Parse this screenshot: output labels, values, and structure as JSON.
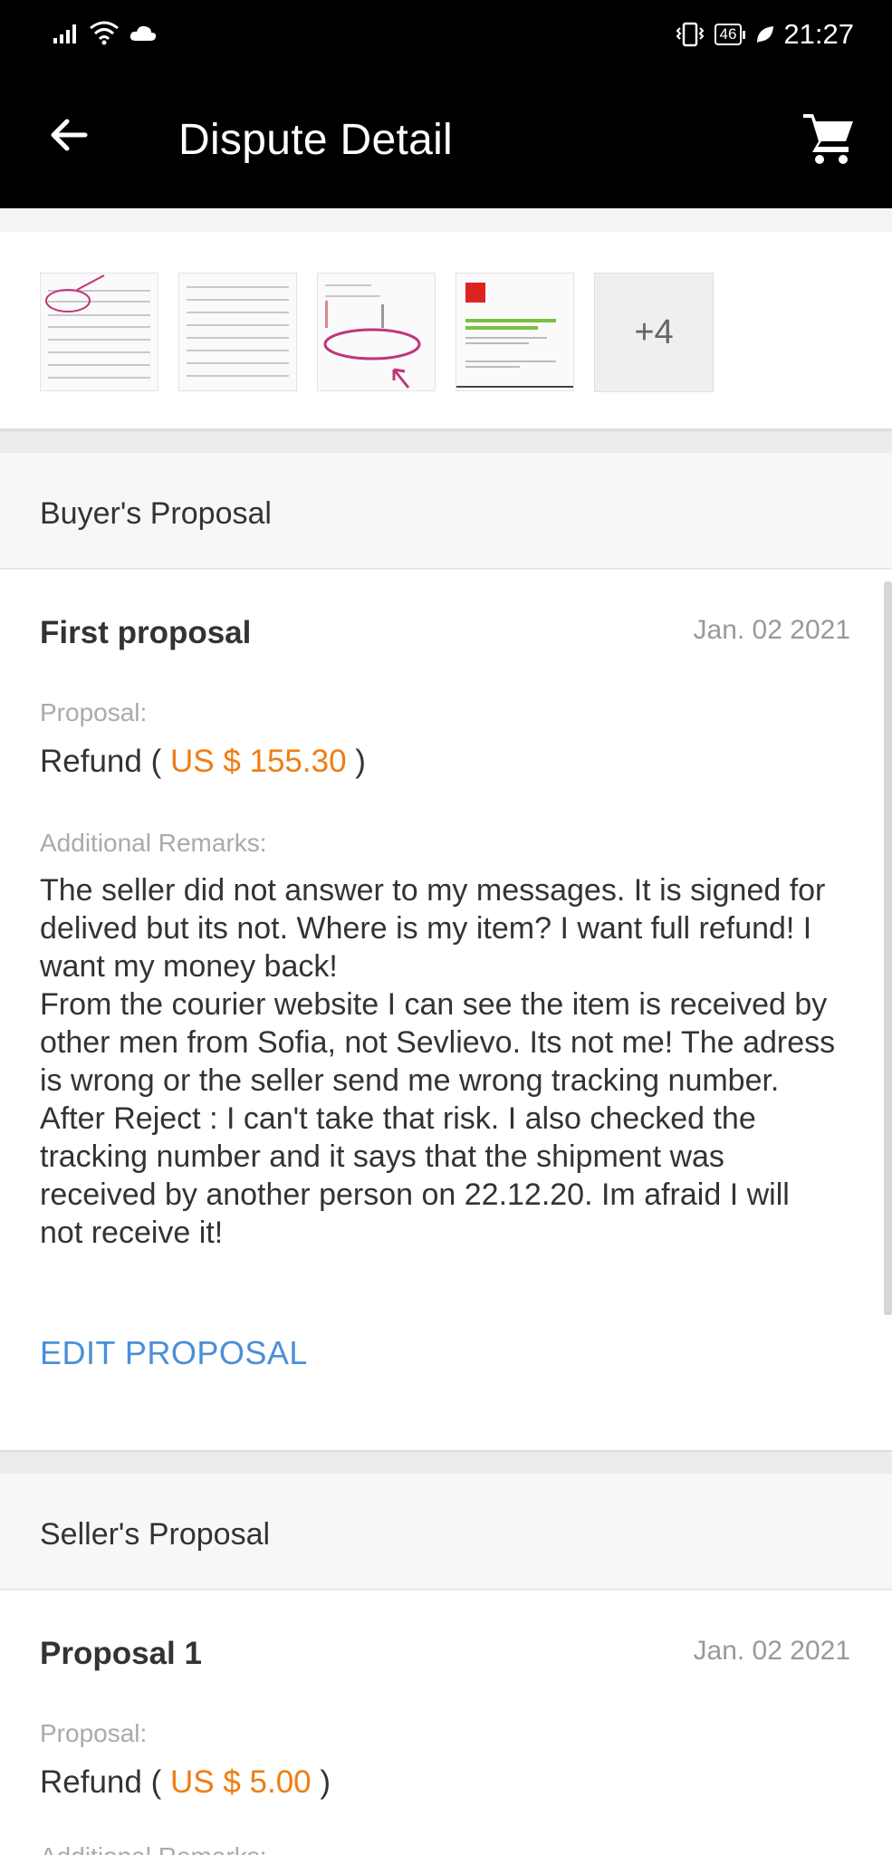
{
  "status_bar": {
    "time": "21:27",
    "battery": "46",
    "icons": [
      "signal-icon",
      "wifi-icon",
      "cloud-icon",
      "vibrate-icon",
      "battery-icon",
      "leaf-icon"
    ]
  },
  "app_bar": {
    "title": "Dispute Detail",
    "back_icon": "arrow-left-icon",
    "cart_icon": "cart-icon",
    "background": "#000000"
  },
  "evidence": {
    "thumbnails": [
      "thumb-1",
      "thumb-2",
      "thumb-3",
      "thumb-4"
    ],
    "more_label": "+4"
  },
  "buyer": {
    "header": "Buyer's Proposal",
    "title": "First proposal",
    "date": "Jan. 02 2021",
    "proposal_label": "Proposal:",
    "refund_prefix": "Refund ( ",
    "amount": "US $ 155.30",
    "refund_suffix": " )",
    "remarks_label": "Additional Remarks:",
    "remarks": "The seller did not answer to my messages. It is signed for delived but its not. Where is my item? I want full refund! I want my money back!\nFrom the courier website I can see the item is received by other men from Sofia, not Sevlievo. Its not me! The adress is wrong or the seller send me wrong tracking number.\nAfter Reject : I can't take that risk. I also checked the tracking number and it says that the shipment was received by another person on 22.12.20. Im afraid I will not receive it!",
    "edit_label": "EDIT PROPOSAL"
  },
  "seller": {
    "header": "Seller's Proposal",
    "title": "Proposal 1",
    "date": "Jan. 02 2021",
    "proposal_label": "Proposal:",
    "refund_prefix": "Refund ( ",
    "amount": "US $ 5.00",
    "refund_suffix": " )",
    "remarks_label": "Additional Remarks:"
  },
  "colors": {
    "accent_amount": "#ef7d12",
    "link": "#4a8fd8",
    "muted": "#aaaaaa"
  }
}
